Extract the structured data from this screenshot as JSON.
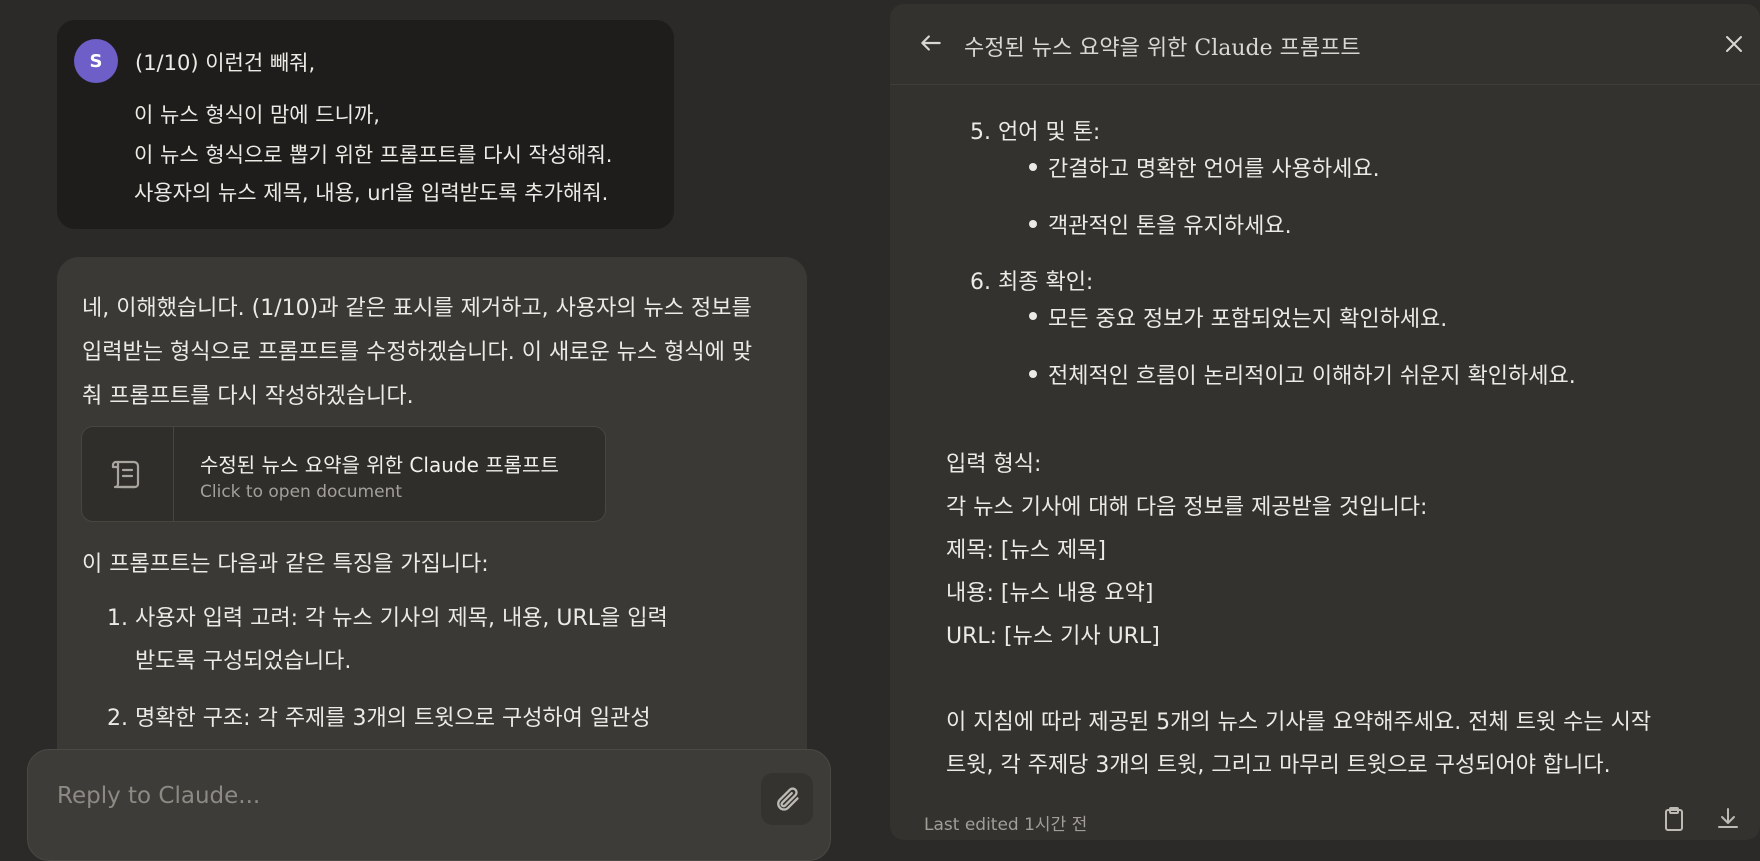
{
  "user_message": {
    "avatar_letter": "S",
    "lines": [
      "(1/10) 이런건 빼줘,",
      "이 뉴스 형식이 맘에 드니까,",
      "이 뉴스 형식으로 뽑기 위한 프롬프트를 다시 작성해줘.",
      "사용자의 뉴스 제목, 내용, url을 입력받도록 추가해줘."
    ]
  },
  "assistant_message": {
    "paragraph": "네, 이해했습니다. (1/10)과 같은 표시를 제거하고, 사용자의 뉴스 정보를 입력받는 형식으로 프롬프트를 수정하겠습니다. 이 새로운 뉴스 형식에 맞춰 프롬프트를 다시 작성하겠습니다.",
    "doc_card": {
      "title": "수정된 뉴스 요약을 위한 Claude 프롬프트",
      "subtitle": "Click to open document"
    },
    "features_intro": "이 프롬프트는 다음과 같은 특징을 가집니다:",
    "features": [
      "1. 사용자 입력 고려: 각 뉴스 기사의 제목, 내용, URL을 입력",
      "받도록 구성되었습니다.",
      "2. 명확한 구조: 각 주제를 3개의 트윗으로 구성하여 일관성"
    ]
  },
  "reply": {
    "placeholder": "Reply to Claude..."
  },
  "document_panel": {
    "title": "수정된 뉴스 요약을 위한 Claude 프롬프트",
    "sections": [
      {
        "heading": "5. 언어 및 톤:",
        "bullets": [
          "간결하고 명확한 언어를 사용하세요.",
          "객관적인 톤을 유지하세요."
        ]
      },
      {
        "heading": "6. 최종 확인:",
        "bullets": [
          "모든 중요 정보가 포함되었는지 확인하세요.",
          "전체적인 흐름이 논리적이고 이해하기 쉬운지 확인하세요."
        ]
      }
    ],
    "input_format": [
      "입력 형식:",
      "각 뉴스 기사에 대해 다음 정보를 제공받을 것입니다:",
      "제목: [뉴스 제목]",
      "내용: [뉴스 내용 요약]",
      "URL: [뉴스 기사 URL]"
    ],
    "closing": [
      "이 지침에 따라 제공된 5개의 뉴스 기사를 요약해주세요. 전체 트윗 수는 시작",
      "트윗, 각 주제당 3개의 트윗, 그리고 마무리 트윗으로 구성되어야 합니다."
    ],
    "footer": "Last edited 1시간 전"
  },
  "colors": {
    "background": "#2b2a28",
    "panel": "#33322f",
    "avatar": "#6e5ec8"
  }
}
